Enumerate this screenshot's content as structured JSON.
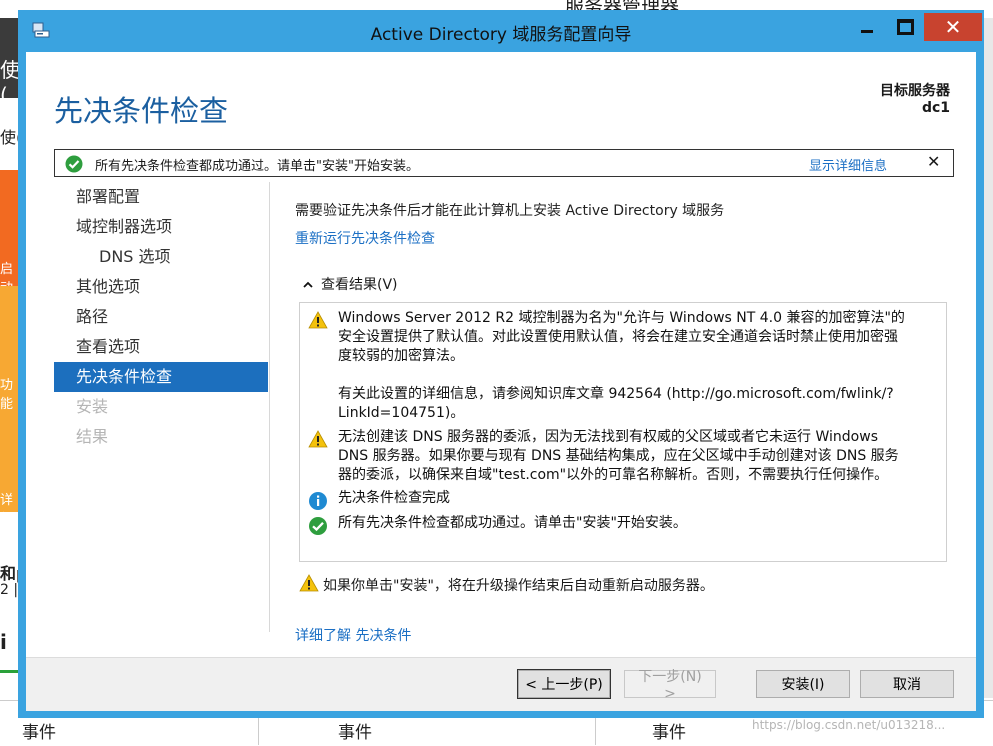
{
  "background": {
    "title": "服务器管理器",
    "left_fragments": [
      "使(",
      "启动",
      "功能",
      "详细",
      "和p",
      "2 |",
      "i"
    ],
    "bottom_columns": [
      "事件",
      "事件",
      "事件"
    ],
    "watermark": "https://blog.csdn.net/u013218..."
  },
  "window": {
    "title": "Active Directory 域服务配置向导",
    "close_glyph": "✕"
  },
  "header": {
    "page_title": "先决条件检查",
    "target_label": "目标服务器",
    "target_value": "dc1"
  },
  "notice": {
    "text": "所有先决条件检查都成功通过。请单击\"安装\"开始安装。",
    "details_link": "显示详细信息",
    "close_glyph": "✕"
  },
  "nav": {
    "items": [
      {
        "label": "部署配置",
        "state": "normal"
      },
      {
        "label": "域控制器选项",
        "state": "normal"
      },
      {
        "label": "DNS 选项",
        "state": "sub"
      },
      {
        "label": "其他选项",
        "state": "normal"
      },
      {
        "label": "路径",
        "state": "normal"
      },
      {
        "label": "查看选项",
        "state": "normal"
      },
      {
        "label": "先决条件检查",
        "state": "active"
      },
      {
        "label": "安装",
        "state": "disabled"
      },
      {
        "label": "结果",
        "state": "disabled"
      }
    ]
  },
  "content": {
    "description": "需要验证先决条件后才能在此计算机上安装 Active Directory 域服务",
    "rerun_link": "重新运行先决条件检查",
    "results_header": "查看结果(V)",
    "results": [
      {
        "icon": "warning-icon",
        "lines": [
          "Windows Server 2012 R2 域控制器为名为\"允许与 Windows NT 4.0 兼容的加密算法\"的",
          "安全设置提供了默认值。对此设置使用默认值，将会在建立安全通道会话时禁止使用加密强",
          "度较弱的加密算法。",
          "",
          "有关此设置的详细信息，请参阅知识库文章 942564 (http://go.microsoft.com/fwlink/?",
          "LinkId=104751)。"
        ]
      },
      {
        "icon": "warning-icon",
        "lines": [
          "无法创建该 DNS 服务器的委派，因为无法找到有权威的父区域或者它未运行 Windows",
          "DNS 服务器。如果你要与现有 DNS 基础结构集成，应在父区域中手动创建对该 DNS 服务",
          "器的委派，以确保来自域\"test.com\"以外的可靠名称解析。否则，不需要执行任何操作。"
        ]
      },
      {
        "icon": "info-icon",
        "lines": [
          "先决条件检查完成"
        ]
      },
      {
        "icon": "success-icon",
        "lines": [
          "所有先决条件检查都成功通过。请单击\"安装\"开始安装。"
        ]
      }
    ],
    "reboot_warning": "如果你单击\"安装\"，将在升级操作结束后自动重新启动服务器。",
    "learn_more_link": "详细了解 先决条件"
  },
  "footer": {
    "prev": "< 上一步(P)",
    "next": "下一步(N) >",
    "install": "安装(I)",
    "cancel": "取消"
  },
  "colors": {
    "window_frame": "#3aa3e0",
    "title_accent": "#1b5fa0",
    "link": "#1b6fc4",
    "nav_active": "#1c6fbe",
    "close_button": "#c8432f",
    "warning": "#f4c20d",
    "info": "#1f8ad2",
    "success": "#2e9e3e"
  }
}
